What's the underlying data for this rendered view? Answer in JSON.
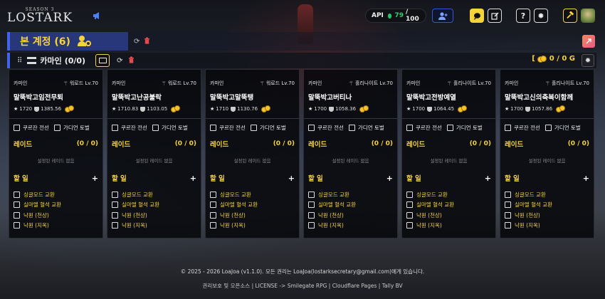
{
  "app": {
    "logo_sub": "SEASON 3",
    "logo_main": "LOSTARK",
    "api_label": "API",
    "api_current": "79",
    "api_total": "/ 100"
  },
  "account": {
    "title": "본 계정 (6)"
  },
  "server": {
    "name": "카마인",
    "count": "(0/0)",
    "gold_open": "[",
    "gold_value": "0 / 0 G"
  },
  "labels": {
    "kurzan": "쿠르잔 전선",
    "guardian": "가디언 토벌",
    "raid": "레이드",
    "raid_count": "(0 / 0)",
    "raid_empty": "설정된 레이드 없음",
    "todo": "할 일",
    "todo_add": "+"
  },
  "todo_items": [
    "싱글모드 교환",
    "실마엘 혈석 교환",
    "낙원 (천상)",
    "낙원 (지옥)"
  ],
  "characters": [
    {
      "server": "카마인",
      "class_level": "워로드 Lv.70",
      "name": "말뚝박고임전무퇴",
      "item_level": "1720",
      "combat": "1385.56"
    },
    {
      "server": "카마인",
      "class_level": "워로드 Lv.70",
      "name": "말뚝박고난공불락",
      "item_level": "1710.83",
      "combat": "1103.05"
    },
    {
      "server": "카마인",
      "class_level": "워로드 Lv.70",
      "name": "말뚝박고말뚝탱",
      "item_level": "1710",
      "combat": "1130.76"
    },
    {
      "server": "카마인",
      "class_level": "홀리나이트 Lv.70",
      "name": "말뚝박고버티나",
      "item_level": "1700",
      "combat": "1058.36"
    },
    {
      "server": "카마인",
      "class_level": "홀리나이트 Lv.70",
      "name": "말뚝박고전방예열",
      "item_level": "1700",
      "combat": "1064.45"
    },
    {
      "server": "카마인",
      "class_level": "홀리나이트 Lv.70",
      "name": "말뚝박고신의축복이함께",
      "item_level": "1700",
      "combat": "1057.86"
    }
  ],
  "footer": {
    "line1": "© 2025 - 2026 LoaJoa (v1.1.0). 모든 권리는 LoaJoa(lostarksecretary@gmail.com)에게 있습니다.",
    "line2": "권리보호 및 오픈소스 | LICENSE -> Smilegate RPG | Cloudflare Pages | Tally BV"
  },
  "colors": {
    "accent_yellow": "#f5d33b",
    "accent_blue": "#4263eb",
    "danger": "#e64a4a",
    "api_green": "#2ecc71"
  }
}
